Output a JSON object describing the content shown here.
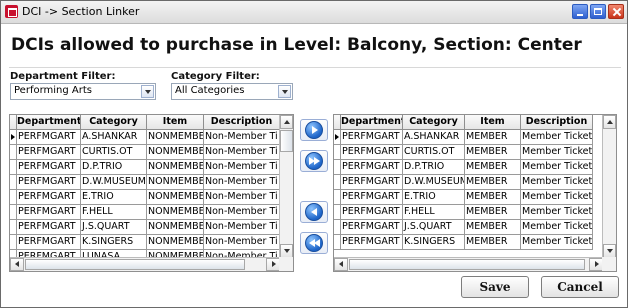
{
  "window": {
    "title": "DCI -> Section Linker"
  },
  "heading": "DCIs allowed to purchase in Level: Balcony, Section: Center",
  "filters": {
    "department_label": "Department Filter:",
    "department_value": "Performing Arts",
    "category_label": "Category Filter:",
    "category_value": "All Categories"
  },
  "left_grid": {
    "columns": [
      "Department",
      "Category",
      "Item",
      "Description"
    ],
    "rows": [
      [
        "PERFMGART",
        "A.SHANKAR",
        "NONMEMBER",
        "Non-Member Ti"
      ],
      [
        "PERFMGART",
        "CURTIS.OT",
        "NONMEMBER",
        "Non-Member Ti"
      ],
      [
        "PERFMGART",
        "D.P.TRIO",
        "NONMEMBER",
        "Non-Member Ti"
      ],
      [
        "PERFMGART",
        "D.W.MUSEUM",
        "NONMEMBER",
        "Non-Member Ti"
      ],
      [
        "PERFMGART",
        "E.TRIO",
        "NONMEMBER",
        "Non-Member Ti"
      ],
      [
        "PERFMGART",
        "F.HELL",
        "NONMEMBER",
        "Non-Member Ti"
      ],
      [
        "PERFMGART",
        "J.S.QUART",
        "NONMEMBER",
        "Non-Member Ti"
      ],
      [
        "PERFMGART",
        "K.SINGERS",
        "NONMEMBER",
        "Non-Member Ti"
      ],
      [
        "PERFMGART",
        "LUNASA",
        "NONMEMBER",
        "Non-Member Ti"
      ]
    ]
  },
  "right_grid": {
    "columns": [
      "Department",
      "Category",
      "Item",
      "Description"
    ],
    "rows": [
      [
        "PERFMGART",
        "A.SHANKAR",
        "MEMBER",
        "Member Ticket"
      ],
      [
        "PERFMGART",
        "CURTIS.OT",
        "MEMBER",
        "Member Ticket"
      ],
      [
        "PERFMGART",
        "D.P.TRIO",
        "MEMBER",
        "Member Ticket"
      ],
      [
        "PERFMGART",
        "D.W.MUSEUM",
        "MEMBER",
        "Member Ticket"
      ],
      [
        "PERFMGART",
        "E.TRIO",
        "MEMBER",
        "Member Ticket"
      ],
      [
        "PERFMGART",
        "F.HELL",
        "MEMBER",
        "Member Ticket"
      ],
      [
        "PERFMGART",
        "J.S.QUART",
        "MEMBER",
        "Member Ticket"
      ],
      [
        "PERFMGART",
        "K.SINGERS",
        "MEMBER",
        "Member Ticket"
      ]
    ]
  },
  "transfer_buttons": [
    "arrow-right-icon",
    "double-arrow-right-icon",
    "arrow-left-icon",
    "double-arrow-left-icon"
  ],
  "buttons": {
    "save": "Save",
    "cancel": "Cancel"
  },
  "colors": {
    "accent": "#2e5fcf",
    "close": "#c8341a",
    "transfer": "#1d64c8"
  }
}
